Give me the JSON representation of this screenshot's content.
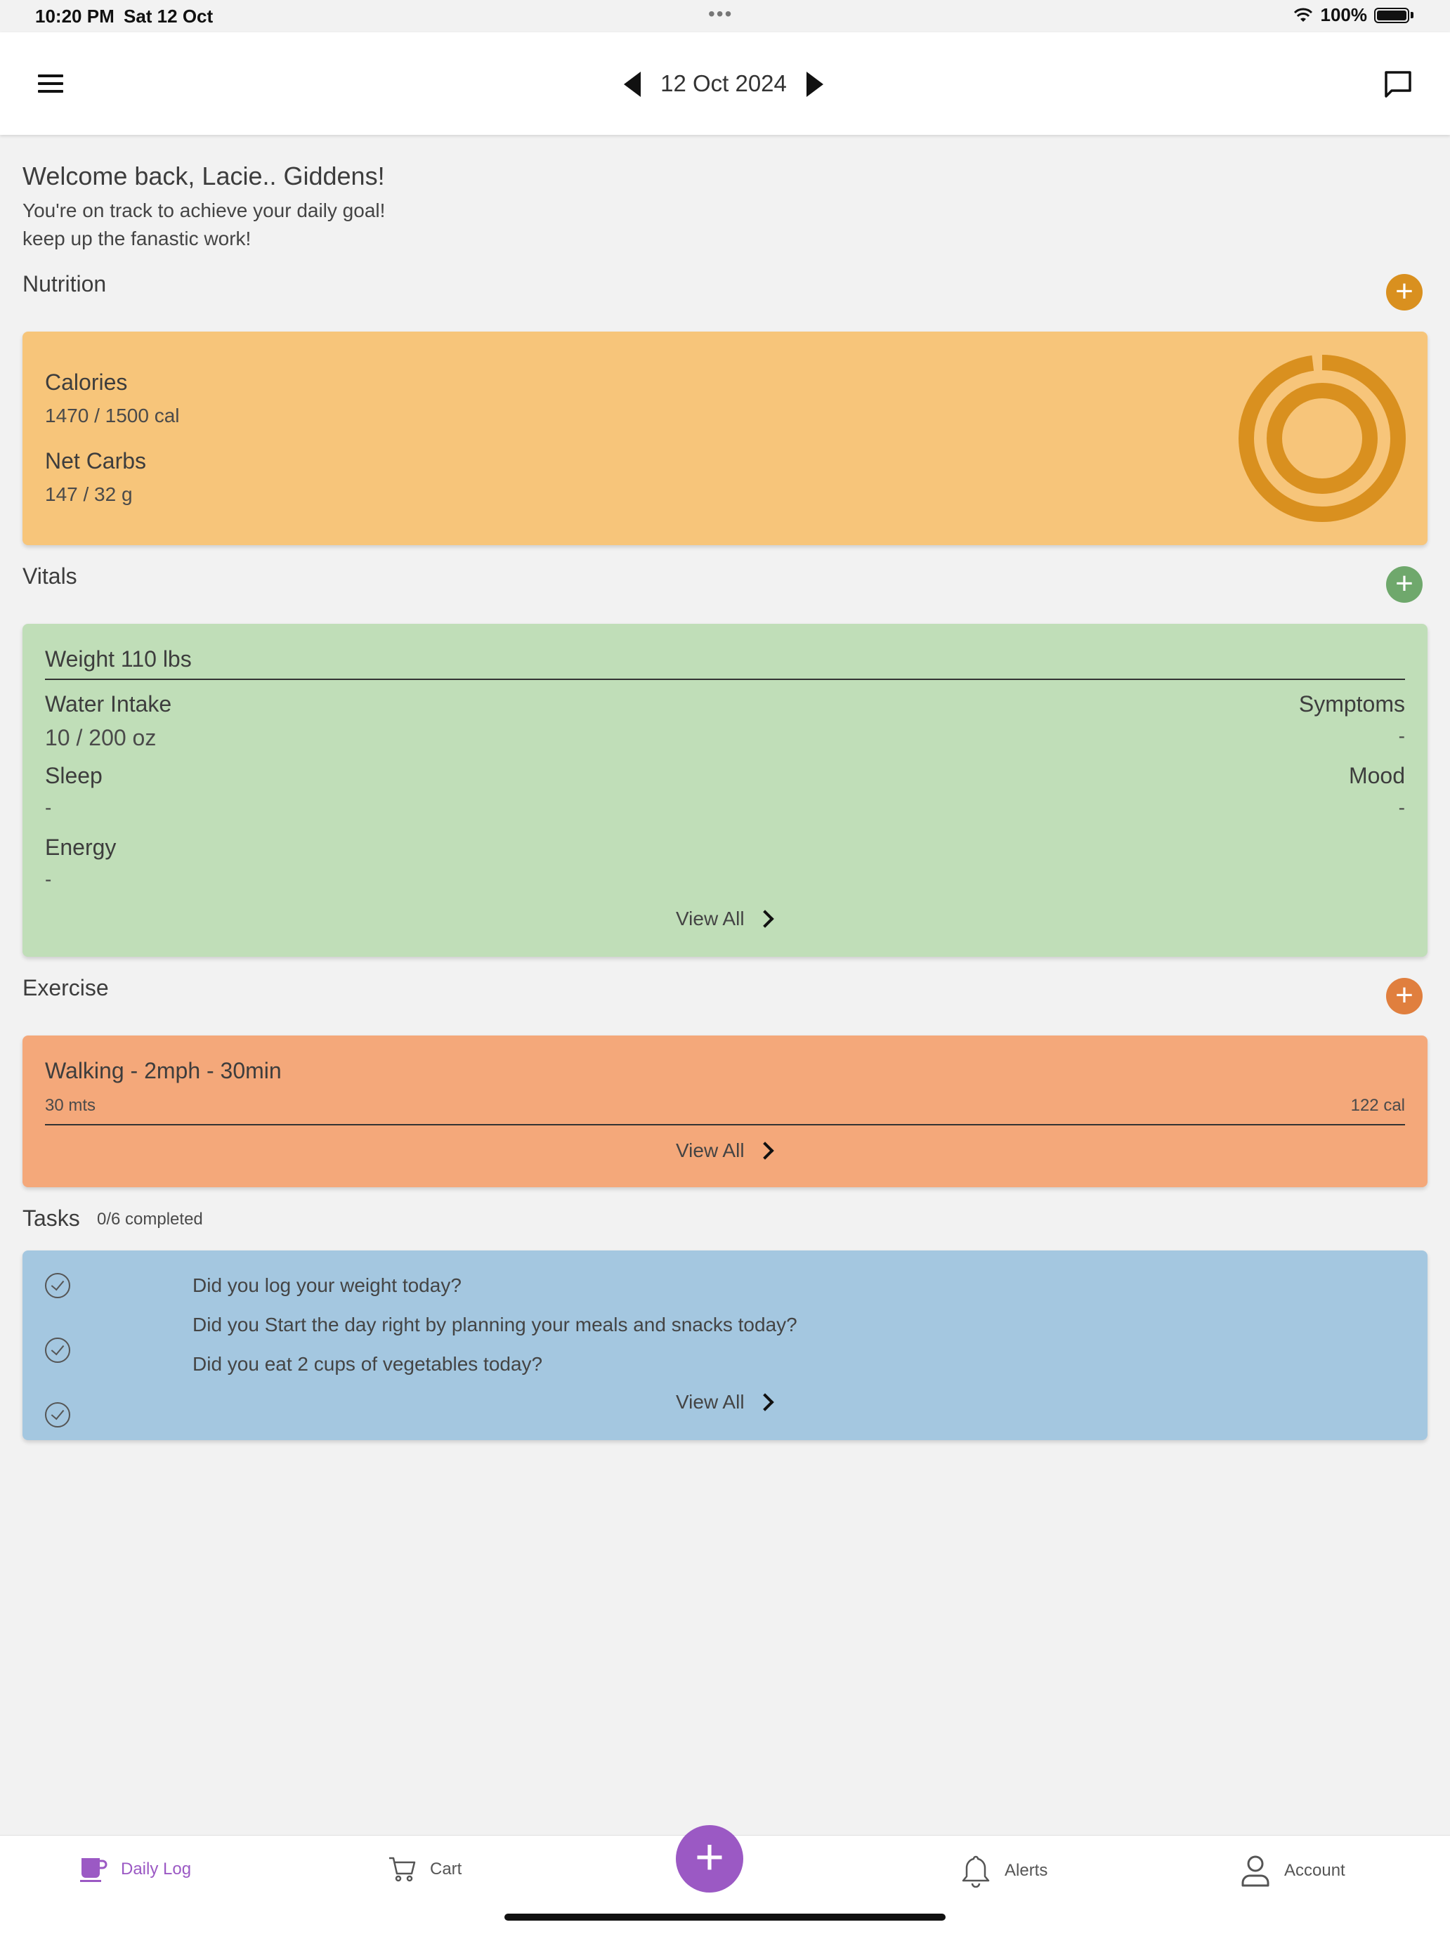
{
  "status_bar": {
    "time": "10:20 PM",
    "date": "Sat 12 Oct",
    "dots": "•••",
    "battery": "100%"
  },
  "header": {
    "date": "12 Oct 2024"
  },
  "welcome": {
    "title": "Welcome back, Lacie.. Giddens!",
    "line1": "You're on track to achieve your daily goal!",
    "line2": "keep up the fanastic work!"
  },
  "nutrition": {
    "title": "Nutrition",
    "calories_label": "Calories",
    "calories_value": "1470 / 1500 cal",
    "carbs_label": "Net Carbs",
    "carbs_value": "147 / 32 g",
    "calories_progress": 0.98,
    "carbs_progress": 1.0,
    "accent": "#d9901f",
    "card_color": "#f7c57a"
  },
  "vitals": {
    "title": "Vitals",
    "weight": "Weight 110 lbs",
    "water_label": "Water Intake",
    "water_value": "10 / 200 oz",
    "symptoms_label": "Symptoms",
    "symptoms_value": "-",
    "sleep_label": "Sleep",
    "sleep_value": "-",
    "mood_label": "Mood",
    "mood_value": "-",
    "energy_label": "Energy",
    "energy_value": "-",
    "view_all": "View All",
    "accent": "#6fa86c",
    "card_color": "#c0deb8"
  },
  "exercise": {
    "title": "Exercise",
    "activity": "Walking - 2mph - 30min",
    "duration": "30 mts",
    "calories": "122 cal",
    "view_all": "View All",
    "accent": "#e07f3e",
    "card_color": "#f4a87a"
  },
  "tasks": {
    "title": "Tasks",
    "completed": "0/6 completed",
    "items": [
      "Did you log your weight today?",
      "Did you Start the day right by planning your meals and snacks today?",
      "Did you eat 2 cups of vegetables today?"
    ],
    "view_all": "View All",
    "card_color": "#a4c7e0"
  },
  "bottom_nav": {
    "items": [
      {
        "label": "Daily Log",
        "icon": "cup-icon",
        "active": true
      },
      {
        "label": "Cart",
        "icon": "cart-icon",
        "active": false
      },
      {
        "label": "Alerts",
        "icon": "bell-icon",
        "active": false
      },
      {
        "label": "Account",
        "icon": "person-icon",
        "active": false
      }
    ],
    "active_color": "#9b59c4",
    "fab_icon": "plus-icon"
  }
}
